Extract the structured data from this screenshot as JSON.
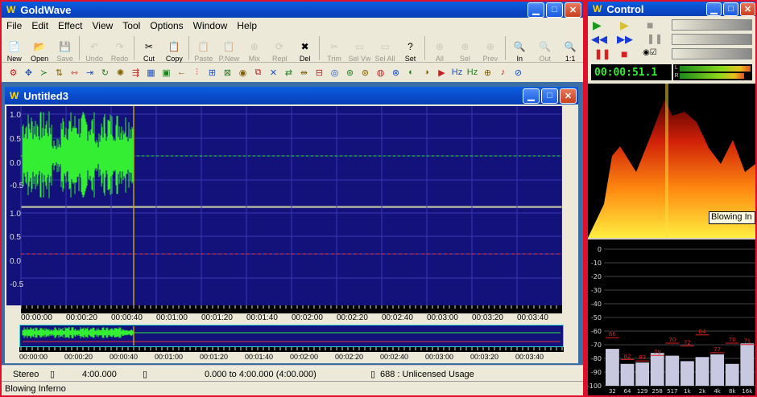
{
  "app": {
    "title": "GoldWave"
  },
  "menu": [
    "File",
    "Edit",
    "Effect",
    "View",
    "Tool",
    "Options",
    "Window",
    "Help"
  ],
  "toolbar": [
    {
      "label": "New",
      "en": true
    },
    {
      "label": "Open",
      "en": true
    },
    {
      "label": "Save",
      "en": false
    },
    {
      "label": "Undo",
      "en": false
    },
    {
      "label": "Redo",
      "en": false
    },
    {
      "label": "Cut",
      "en": true
    },
    {
      "label": "Copy",
      "en": true
    },
    {
      "label": "Paste",
      "en": false
    },
    {
      "label": "P.New",
      "en": false
    },
    {
      "label": "Mix",
      "en": false
    },
    {
      "label": "Repl",
      "en": false
    },
    {
      "label": "Del",
      "en": true
    },
    {
      "label": "Trim",
      "en": false
    },
    {
      "label": "Sel Vw",
      "en": false
    },
    {
      "label": "Sel All",
      "en": false
    },
    {
      "label": "Set",
      "en": true
    },
    {
      "label": "All",
      "en": false
    },
    {
      "label": "Sel",
      "en": false
    },
    {
      "label": "Prev",
      "en": false
    },
    {
      "label": "In",
      "en": true
    },
    {
      "label": "Out",
      "en": false
    },
    {
      "label": "1:1",
      "en": true
    }
  ],
  "doc": {
    "title": "Untitled3",
    "y_labels_top": [
      "1.0",
      "0.5",
      "0.0",
      "-0.5"
    ],
    "y_labels_bottom": [
      "1.0",
      "0.5",
      "0.0",
      "-0.5"
    ],
    "time_ticks": [
      "00:00:00",
      "00:00:20",
      "00:00:40",
      "00:01:00",
      "00:01:20",
      "00:01:40",
      "00:02:00",
      "00:02:20",
      "00:02:40",
      "00:03:00",
      "00:03:20",
      "00:03:40"
    ],
    "overview_ticks": [
      "00:00:00",
      "00:00:20",
      "00:00:40",
      "00:01:00",
      "00:01:20",
      "00:01:40",
      "00:02:00",
      "00:02:20",
      "00:02:40",
      "00:03:00",
      "00:03:20",
      "00:03:40"
    ]
  },
  "status": {
    "channels": "Stereo",
    "length": "4:00.000",
    "selection": "0.000 to 4:00.000 (4:00.000)",
    "usage": "688 : Unlicensed Usage",
    "bottom": "Blowing Inferno"
  },
  "control": {
    "title": "Control",
    "time": "00:00:51.1",
    "meter_l": "L",
    "meter_r": "R",
    "tooltip": "Blowing In",
    "db_labels": [
      "0",
      "-10",
      "-20",
      "-30",
      "-40",
      "-50",
      "-60",
      "-70",
      "-80",
      "-90",
      "-100"
    ],
    "freq_labels": [
      "32",
      "64",
      "129",
      "258",
      "517",
      "1k",
      "2k",
      "4k",
      "8k",
      "16k"
    ],
    "bars": [
      {
        "level": -73,
        "peak": "66"
      },
      {
        "level": -84,
        "peak": "82"
      },
      {
        "level": -83,
        "peak": "83"
      },
      {
        "level": -76,
        "peak": "79"
      },
      {
        "level": -78,
        "peak": "70"
      },
      {
        "level": -82,
        "peak": "72"
      },
      {
        "level": -79,
        "peak": "64"
      },
      {
        "level": -77,
        "peak": "77"
      },
      {
        "level": -84,
        "peak": "70"
      },
      {
        "level": -69,
        "peak": "71"
      }
    ]
  }
}
